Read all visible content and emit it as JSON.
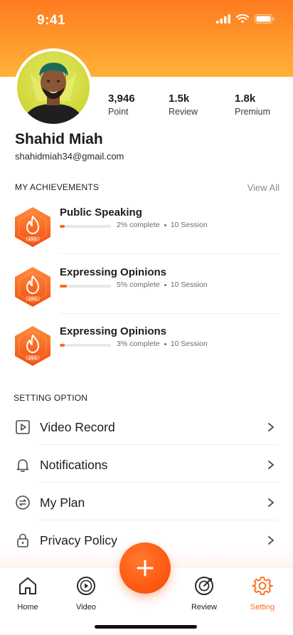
{
  "status_bar": {
    "time": "9:41"
  },
  "profile": {
    "name": "Shahid Miah",
    "email": "shahidmiah34@gmail.com",
    "stats": [
      {
        "value": "3,946",
        "label": "Point"
      },
      {
        "value": "1.5k",
        "label": "Review"
      },
      {
        "value": "1.8k",
        "label": "Premium"
      }
    ]
  },
  "achievements": {
    "title": "MY ACHIEVEMENTS",
    "view_all": "View All",
    "items": [
      {
        "title": "Public Speaking",
        "progress": 0.02,
        "progress_text": "2% complete",
        "sessions": "10 Session",
        "badge_label": "LV.1"
      },
      {
        "title": "Expressing Opinions",
        "progress": 0.05,
        "progress_text": "5% complete",
        "sessions": "10 Session",
        "badge_label": "LV.1"
      },
      {
        "title": "Expressing Opinions",
        "progress": 0.03,
        "progress_text": "3% complete",
        "sessions": "10 Session",
        "badge_label": "LV.1"
      }
    ]
  },
  "settings": {
    "title": "SETTING OPTION",
    "items": [
      {
        "label": "Video Record",
        "icon": "video-record-icon"
      },
      {
        "label": "Notifications",
        "icon": "bell-icon"
      },
      {
        "label": "My Plan",
        "icon": "swap-icon"
      },
      {
        "label": "Privacy Policy",
        "icon": "lock-icon"
      }
    ]
  },
  "bottom_nav": {
    "items": [
      {
        "label": "Home",
        "icon": "home-icon",
        "active": false
      },
      {
        "label": "Video",
        "icon": "play-circle-icon",
        "active": false
      },
      {
        "label": "Review",
        "icon": "target-icon",
        "active": false
      },
      {
        "label": "Setting",
        "icon": "gear-icon",
        "active": true
      }
    ],
    "fab_icon": "plus-icon"
  },
  "colors": {
    "accent": "#ff6a1a",
    "header_top": "#ff7a1f",
    "header_bottom": "#ffb23a",
    "text": "#1c1c1c",
    "muted": "#8a8a8a"
  }
}
